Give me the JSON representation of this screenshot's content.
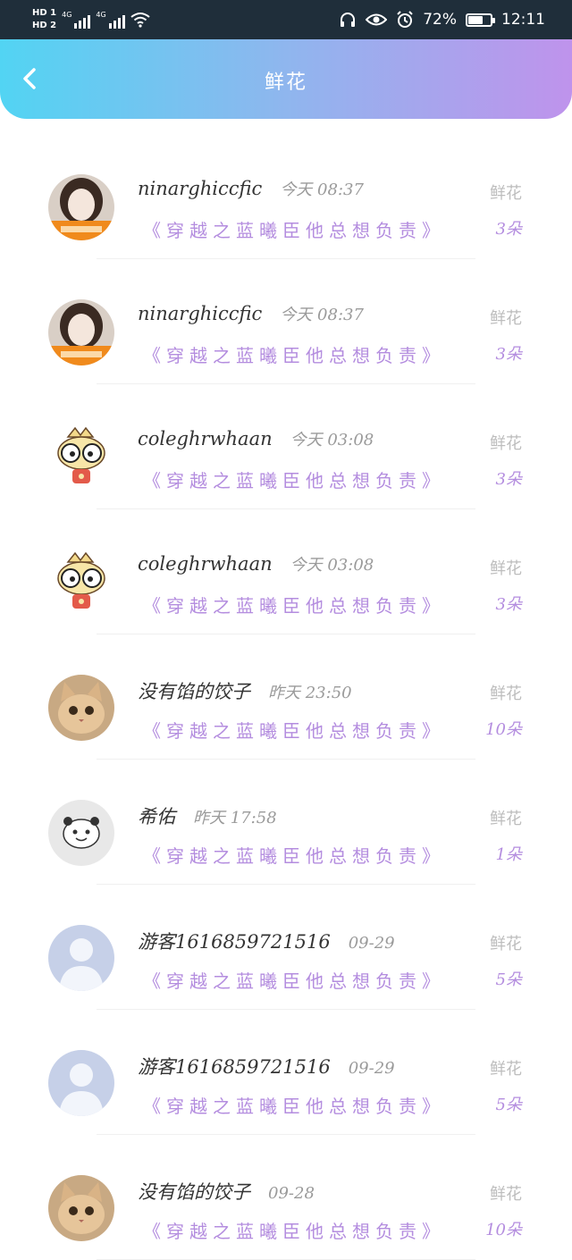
{
  "status_bar": {
    "sim1": "HD 1",
    "sim2": "HD 2",
    "network1": "4G",
    "network2": "4G",
    "battery_text": "72%",
    "battery_level": 0.72,
    "time": "12:11",
    "icons": [
      "headphones-icon",
      "eye-icon",
      "alarm-icon",
      "wifi-icon",
      "battery-icon"
    ]
  },
  "header": {
    "title": "鲜花",
    "gradient": [
      "#52d4f3",
      "#bf93ec"
    ]
  },
  "items": [
    {
      "user": "ninarghiccfic",
      "time": "今天 08:37",
      "book": "《穿越之蓝曦臣他总想负责》",
      "gift": "鲜花",
      "count": "3朵",
      "avatar": "photo"
    },
    {
      "user": "ninarghiccfic",
      "time": "今天 08:37",
      "book": "《穿越之蓝曦臣他总想负责》",
      "gift": "鲜花",
      "count": "3朵",
      "avatar": "photo"
    },
    {
      "user": "coleghrwhaan",
      "time": "今天 03:08",
      "book": "《穿越之蓝曦臣他总想负责》",
      "gift": "鲜花",
      "count": "3朵",
      "avatar": "cartoon"
    },
    {
      "user": "coleghrwhaan",
      "time": "今天 03:08",
      "book": "《穿越之蓝曦臣他总想负责》",
      "gift": "鲜花",
      "count": "3朵",
      "avatar": "cartoon"
    },
    {
      "user": "没有馅的饺子",
      "time": "昨天 23:50",
      "book": "《穿越之蓝曦臣他总想负责》",
      "gift": "鲜花",
      "count": "10朵",
      "avatar": "cat"
    },
    {
      "user": "希佑",
      "time": "昨天 17:58",
      "book": "《穿越之蓝曦臣他总想负责》",
      "gift": "鲜花",
      "count": "1朵",
      "avatar": "panda"
    },
    {
      "user": "游客1616859721516",
      "time": "09-29",
      "book": "《穿越之蓝曦臣他总想负责》",
      "gift": "鲜花",
      "count": "5朵",
      "avatar": "default"
    },
    {
      "user": "游客1616859721516",
      "time": "09-29",
      "book": "《穿越之蓝曦臣他总想负责》",
      "gift": "鲜花",
      "count": "5朵",
      "avatar": "default"
    },
    {
      "user": "没有馅的饺子",
      "time": "09-28",
      "book": "《穿越之蓝曦臣他总想负责》",
      "gift": "鲜花",
      "count": "10朵",
      "avatar": "cat"
    }
  ]
}
